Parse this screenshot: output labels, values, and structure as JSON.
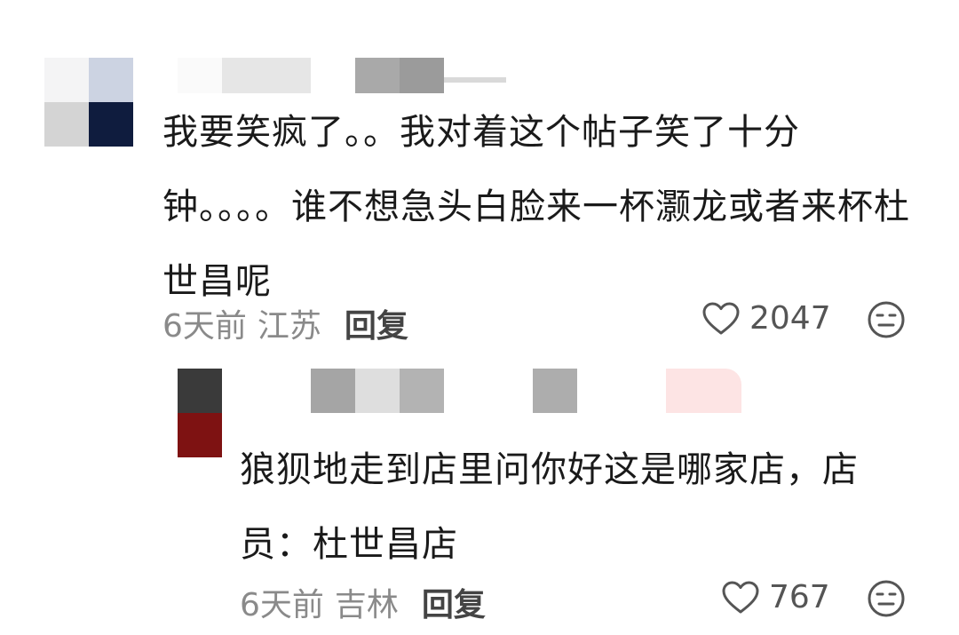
{
  "comments": [
    {
      "text": "我要笑疯了。。我对着这个帖子笑了十分钟。。。。谁不想急头白脸来一杯灏龙或者来杯杜世昌呢",
      "time": "6天前",
      "location": "江苏",
      "reply_label": "回复",
      "likes": "2047"
    },
    {
      "text": "狼狈地走到店里问你好这是哪家店，店员：杜世昌店",
      "time": "6天前",
      "location": "吉林",
      "reply_label": "回复",
      "likes": "767"
    }
  ],
  "icons": {
    "like": "heart-outline-icon",
    "reaction": "neutral-face-icon"
  },
  "colors": {
    "text": "#1a1a1a",
    "meta": "#8a8a8a",
    "icon": "#555555"
  }
}
